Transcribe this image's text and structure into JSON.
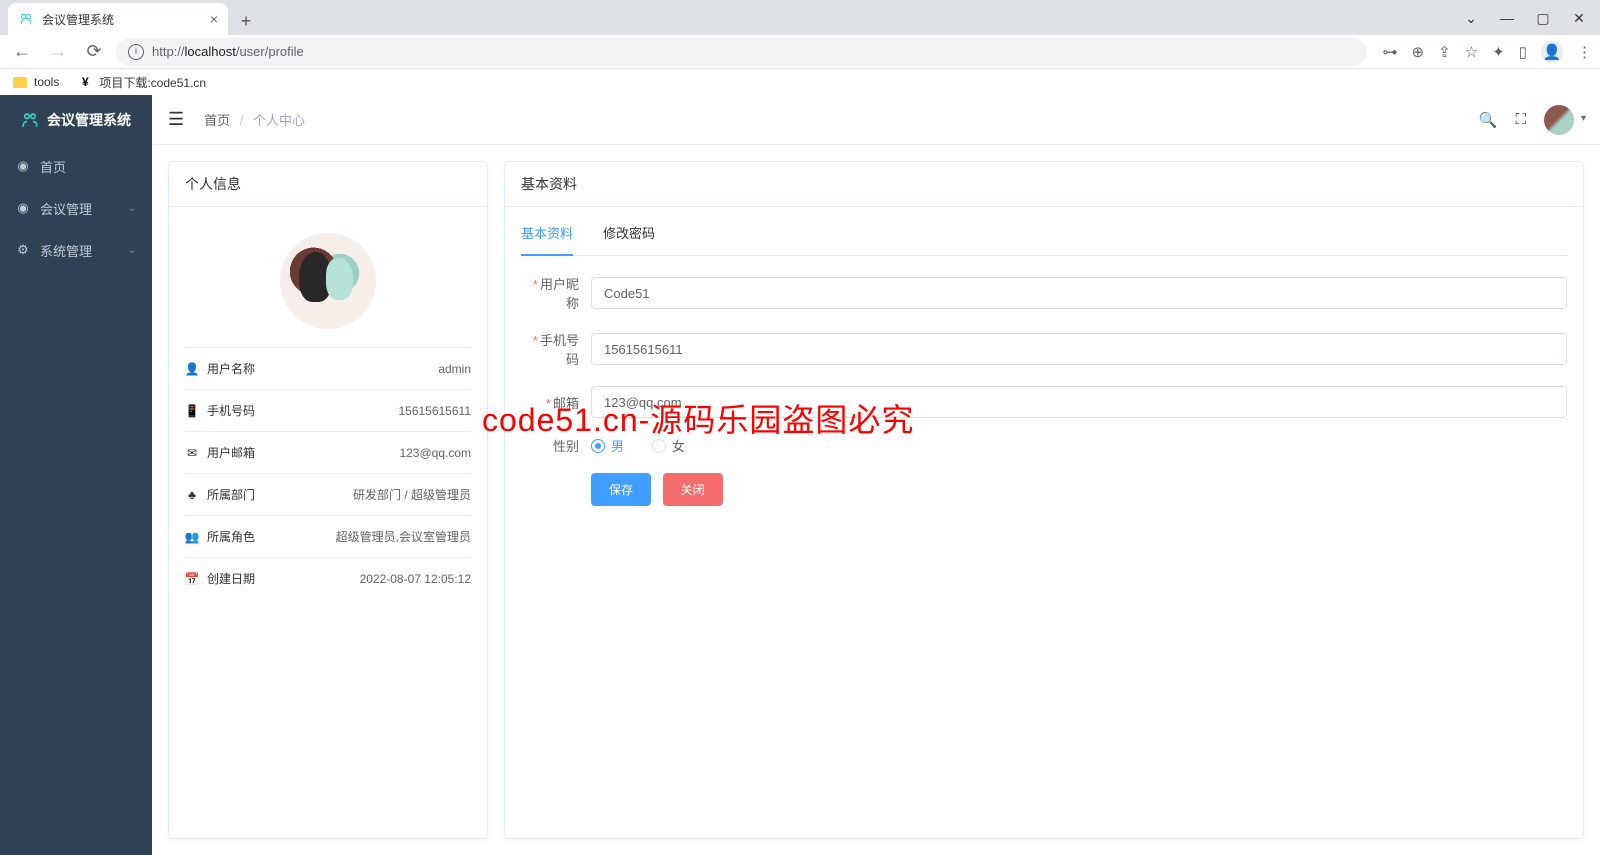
{
  "browser": {
    "tab_title": "会议管理系统",
    "url_display": "http://localhost/user/profile",
    "url_host_bold": "localhost",
    "bookmarks": [
      {
        "label": "tools",
        "icon": "folder"
      },
      {
        "label": "项目下载:code51.cn",
        "icon": "y"
      }
    ]
  },
  "sidebar": {
    "brand": "会议管理系统",
    "items": [
      {
        "icon": "globe",
        "label": "首页",
        "has_children": false
      },
      {
        "icon": "globe",
        "label": "会议管理",
        "has_children": true
      },
      {
        "icon": "gear",
        "label": "系统管理",
        "has_children": true
      }
    ]
  },
  "topbar": {
    "breadcrumb_home": "首页",
    "breadcrumb_current": "个人中心"
  },
  "profile_panel": {
    "header": "个人信息",
    "fields": [
      {
        "icon": "user",
        "label": "用户名称",
        "value": "admin"
      },
      {
        "icon": "phone",
        "label": "手机号码",
        "value": "15615615611"
      },
      {
        "icon": "mail",
        "label": "用户邮箱",
        "value": "123@qq.com"
      },
      {
        "icon": "org",
        "label": "所属部门",
        "value": "研发部门 / 超级管理员"
      },
      {
        "icon": "people",
        "label": "所属角色",
        "value": "超级管理员,会议室管理员"
      },
      {
        "icon": "calendar",
        "label": "创建日期",
        "value": "2022-08-07 12:05:12"
      }
    ]
  },
  "basic_panel": {
    "header": "基本资料",
    "tabs": {
      "basic": "基本资料",
      "password": "修改密码"
    },
    "form": {
      "nickname_label": "用户昵称",
      "nickname_value": "Code51",
      "phone_label": "手机号码",
      "phone_value": "15615615611",
      "email_label": "邮箱",
      "email_value": "123@qq.com",
      "gender_label": "性别",
      "gender_options": {
        "male": "男",
        "female": "女"
      },
      "gender_selected": "male",
      "save_label": "保存",
      "close_label": "关闭"
    }
  },
  "watermark": "code51.cn-源码乐园盗图必究"
}
